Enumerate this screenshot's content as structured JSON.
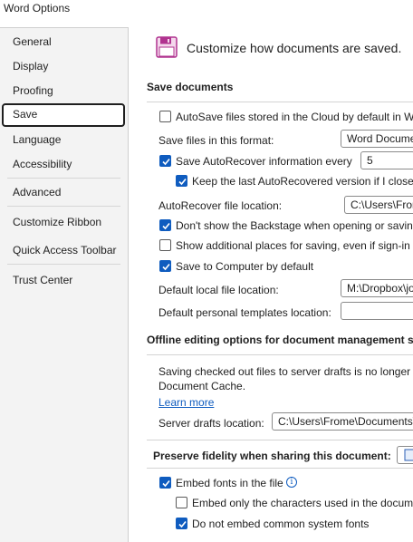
{
  "window": {
    "title": "Word Options"
  },
  "sidebar": {
    "items": [
      {
        "label": "General"
      },
      {
        "label": "Display"
      },
      {
        "label": "Proofing"
      },
      {
        "label": "Save"
      },
      {
        "label": "Language"
      },
      {
        "label": "Accessibility"
      },
      {
        "label": "Advanced"
      },
      {
        "label": "Customize Ribbon"
      },
      {
        "label": "Quick Access Toolbar"
      },
      {
        "label": "Trust Center"
      }
    ],
    "selected": "Save"
  },
  "header": {
    "text": "Customize how documents are saved.",
    "icon": "save-floppy-icon",
    "icon_color": "#b0338f"
  },
  "save_documents": {
    "title": "Save documents",
    "autosave_cloud": {
      "label": "AutoSave files stored in the Cloud by default in Wo",
      "checked": false
    },
    "format_label": "Save files in this format:",
    "format_value": "Word Docume",
    "autorecover": {
      "label": "Save AutoRecover information every",
      "checked": true,
      "minutes": "5"
    },
    "keep_last": {
      "label": "Keep the last AutoRecovered version if I close w",
      "checked": true
    },
    "autorecover_location_label": "AutoRecover file location:",
    "autorecover_location_value": "C:\\Users\\From",
    "dont_show_backstage": {
      "label": "Don't show the Backstage when opening or saving",
      "checked": true
    },
    "show_additional": {
      "label": "Show additional places for saving, even if sign-in m",
      "checked": false
    },
    "save_to_computer": {
      "label": "Save to Computer by default",
      "checked": true
    },
    "default_local_label": "Default local file location:",
    "default_local_value": "M:\\Dropbox\\jo",
    "default_templates_label": "Default personal templates location:",
    "default_templates_value": ""
  },
  "offline": {
    "title": "Offline editing options for document management se",
    "description_line1": "Saving checked out files to server drafts is no longer s",
    "description_line2": "Document Cache.",
    "learn_more": "Learn more",
    "server_drafts_label": "Server drafts location:",
    "server_drafts_value": "C:\\Users\\Frome\\Documents\\S"
  },
  "fidelity": {
    "title": "Preserve fidelity when sharing this document:",
    "embed_fonts": {
      "label": "Embed fonts in the file",
      "checked": true
    },
    "embed_only_used": {
      "label": "Embed only the characters used in the docume",
      "checked": false
    },
    "no_common_fonts": {
      "label": "Do not embed common system fonts",
      "checked": true
    }
  },
  "colors": {
    "accent": "#0f5cbf",
    "sidebar_bg": "#f3f3f3"
  }
}
